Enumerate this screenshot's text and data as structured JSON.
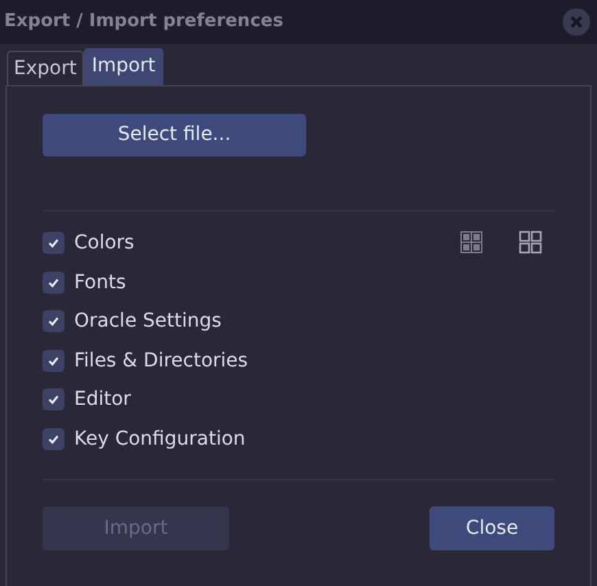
{
  "window": {
    "title": "Export / Import preferences"
  },
  "tabs": [
    {
      "label": "Export",
      "selected": false
    },
    {
      "label": "Import",
      "selected": true
    }
  ],
  "select_button": {
    "label": "Select file..."
  },
  "options": [
    {
      "label": "Colors",
      "checked": true
    },
    {
      "label": "Fonts",
      "checked": true
    },
    {
      "label": "Oracle Settings",
      "checked": true
    },
    {
      "label": "Files & Directories",
      "checked": true
    },
    {
      "label": "Editor",
      "checked": true
    },
    {
      "label": "Key Configuration",
      "checked": true
    }
  ],
  "buttons": [
    {
      "label": "Import",
      "disabled": true
    },
    {
      "label": "Close",
      "disabled": false
    }
  ]
}
